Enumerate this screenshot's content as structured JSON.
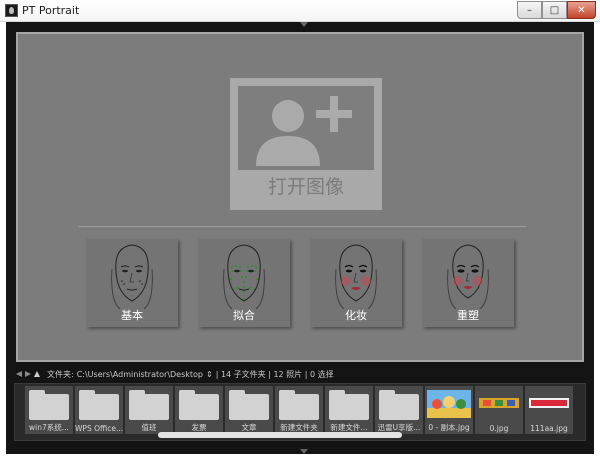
{
  "window": {
    "title": "PT Portrait",
    "controls": {
      "minimize": "–",
      "maximize": "□",
      "close": "✕"
    }
  },
  "open_image": {
    "label": "打开图像",
    "icon": "add-person-icon"
  },
  "modes": [
    {
      "id": "basic",
      "label": "基本"
    },
    {
      "id": "fit",
      "label": "拟合"
    },
    {
      "id": "makeup",
      "label": "化妆"
    },
    {
      "id": "reshape",
      "label": "重塑"
    }
  ],
  "pathbar": {
    "prefix": "文件夹:",
    "path": "C:\\Users\\Administrator\\Desktop",
    "summary": "| 14 子文件夹 | 12 照片 | 0 选择"
  },
  "filmstrip": {
    "items": [
      {
        "type": "folder",
        "name": "win7系统..."
      },
      {
        "type": "folder",
        "name": "WPS Office..."
      },
      {
        "type": "folder",
        "name": "值班"
      },
      {
        "type": "folder",
        "name": "发票"
      },
      {
        "type": "folder",
        "name": "文章"
      },
      {
        "type": "folder",
        "name": "新建文件夹"
      },
      {
        "type": "folder",
        "name": "新建文件..."
      },
      {
        "type": "folder",
        "name": "迅雷U享版..."
      },
      {
        "type": "image",
        "name": "0 - 副本.jpg"
      },
      {
        "type": "image",
        "name": "0.jpg"
      },
      {
        "type": "image",
        "name": "111aa.jpg"
      }
    ]
  },
  "colors": {
    "workspace": "#141414",
    "canvas": "#7c7c7c",
    "card": "#747474",
    "fit_dots": "#2d8f2d",
    "makeup_blush": "#c04a55"
  }
}
